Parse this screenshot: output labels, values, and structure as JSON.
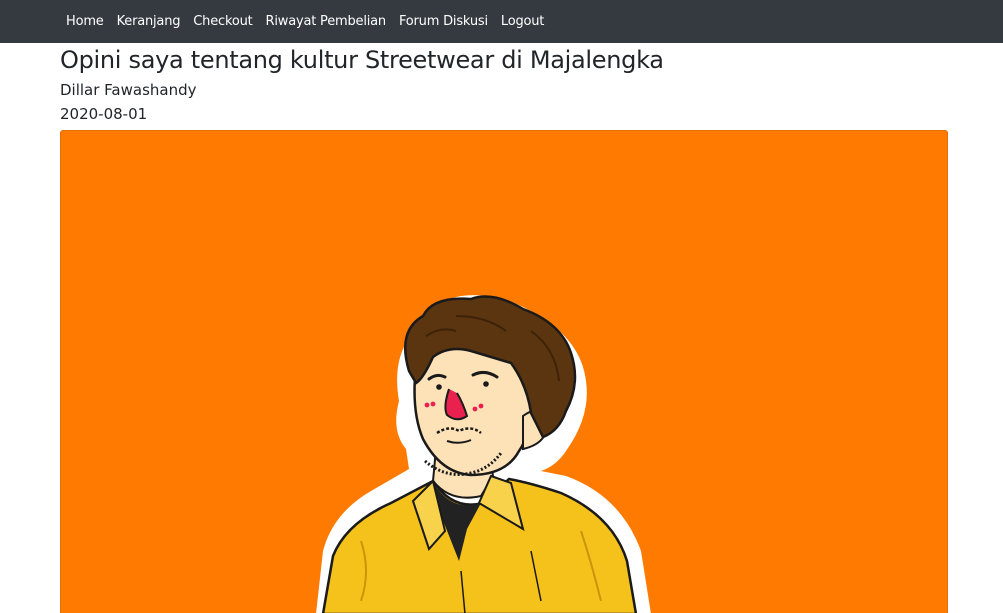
{
  "nav": {
    "items": [
      {
        "label": "Home"
      },
      {
        "label": "Keranjang"
      },
      {
        "label": "Checkout"
      },
      {
        "label": "Riwayat Pembelian"
      },
      {
        "label": "Forum Diskusi"
      },
      {
        "label": "Logout"
      }
    ]
  },
  "article": {
    "title": "Opini saya tentang kultur Streetwear di Majalengka",
    "author": "Dillar Fawashandy",
    "date": "2020-08-01"
  },
  "colors": {
    "navbar": "#343a40",
    "hero_background": "#ff7a00",
    "shirt": "#f5c21b",
    "hair": "#5a3510"
  }
}
